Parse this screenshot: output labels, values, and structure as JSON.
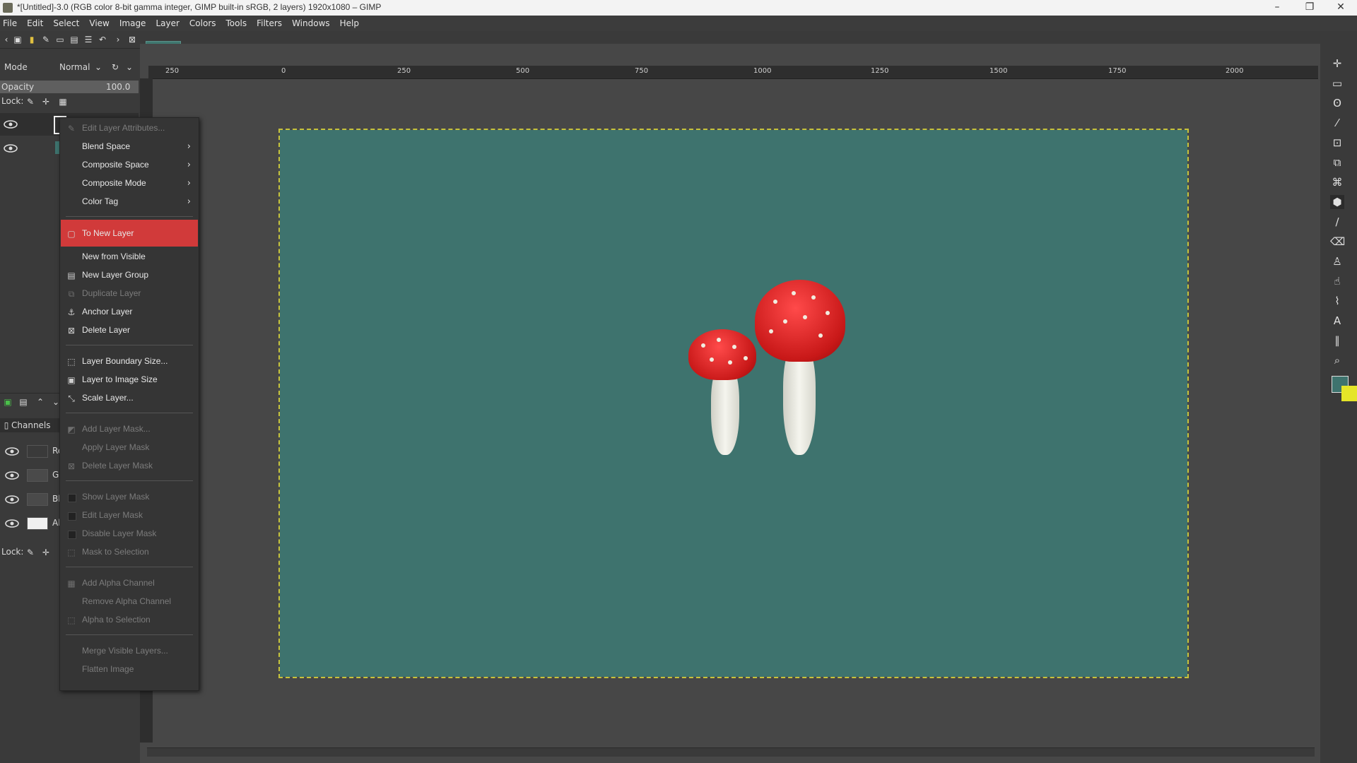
{
  "window": {
    "title": "*[Untitled]-3.0 (RGB color 8-bit gamma integer, GIMP built-in sRGB, 2 layers) 1920x1080 – GIMP",
    "minimize": "–",
    "maximize": "❐",
    "close": "✕"
  },
  "menubar": [
    "File",
    "Edit",
    "Select",
    "View",
    "Image",
    "Layer",
    "Colors",
    "Tools",
    "Filters",
    "Windows",
    "Help"
  ],
  "layers_panel": {
    "mode_label": "Mode",
    "mode_value": "Normal",
    "opacity_label": "Opacity",
    "opacity_value": "100.0",
    "lock_label": "Lock:"
  },
  "channels_panel": {
    "tab_label": "Channels",
    "lock_label": "Lock:",
    "channels": [
      "Re",
      "Gr",
      "Bl",
      "Al"
    ]
  },
  "ruler": {
    "ticks": [
      "250",
      "0",
      "250",
      "500",
      "750",
      "1000",
      "1250",
      "1500",
      "1750",
      "2000"
    ]
  },
  "context_menu": {
    "items": [
      {
        "label": "Edit Layer Attributes...",
        "enabled": false,
        "icon": "pencil-icon"
      },
      {
        "label": "Blend Space",
        "enabled": true,
        "submenu": true
      },
      {
        "label": "Composite Space",
        "enabled": true,
        "submenu": true
      },
      {
        "label": "Composite Mode",
        "enabled": true,
        "submenu": true
      },
      {
        "label": "Color Tag",
        "enabled": true,
        "submenu": true
      },
      {
        "label": "To New Layer",
        "enabled": true,
        "highlighted": true,
        "icon": "new-layer-icon"
      },
      {
        "label": "New from Visible",
        "enabled": true
      },
      {
        "label": "New Layer Group",
        "enabled": true,
        "icon": "layer-group-icon"
      },
      {
        "label": "Duplicate Layer",
        "enabled": false,
        "icon": "duplicate-icon"
      },
      {
        "label": "Anchor Layer",
        "enabled": true,
        "icon": "anchor-icon"
      },
      {
        "label": "Delete Layer",
        "enabled": true,
        "icon": "delete-icon"
      },
      {
        "label": "Layer Boundary Size...",
        "enabled": true,
        "icon": "boundary-icon"
      },
      {
        "label": "Layer to Image Size",
        "enabled": true,
        "icon": "layer-to-image-icon"
      },
      {
        "label": "Scale Layer...",
        "enabled": true,
        "icon": "scale-icon"
      },
      {
        "label": "Add Layer Mask...",
        "enabled": false,
        "icon": "mask-icon"
      },
      {
        "label": "Apply Layer Mask",
        "enabled": false
      },
      {
        "label": "Delete Layer Mask",
        "enabled": false,
        "icon": "delete-icon"
      },
      {
        "label": "Show Layer Mask",
        "enabled": false,
        "checkbox": true
      },
      {
        "label": "Edit Layer Mask",
        "enabled": false,
        "checkbox": true
      },
      {
        "label": "Disable Layer Mask",
        "enabled": false,
        "checkbox": true
      },
      {
        "label": "Mask to Selection",
        "enabled": false,
        "icon": "selection-icon"
      },
      {
        "label": "Add Alpha Channel",
        "enabled": false,
        "icon": "alpha-icon"
      },
      {
        "label": "Remove Alpha Channel",
        "enabled": false
      },
      {
        "label": "Alpha to Selection",
        "enabled": false,
        "icon": "selection-icon"
      },
      {
        "label": "Merge Visible Layers...",
        "enabled": false
      },
      {
        "label": "Flatten Image",
        "enabled": false
      }
    ]
  },
  "colors": {
    "canvas_fill": "#3e736e",
    "highlight": "#d13a3a",
    "foreground": "#3e736e",
    "background": "#e5e528"
  }
}
